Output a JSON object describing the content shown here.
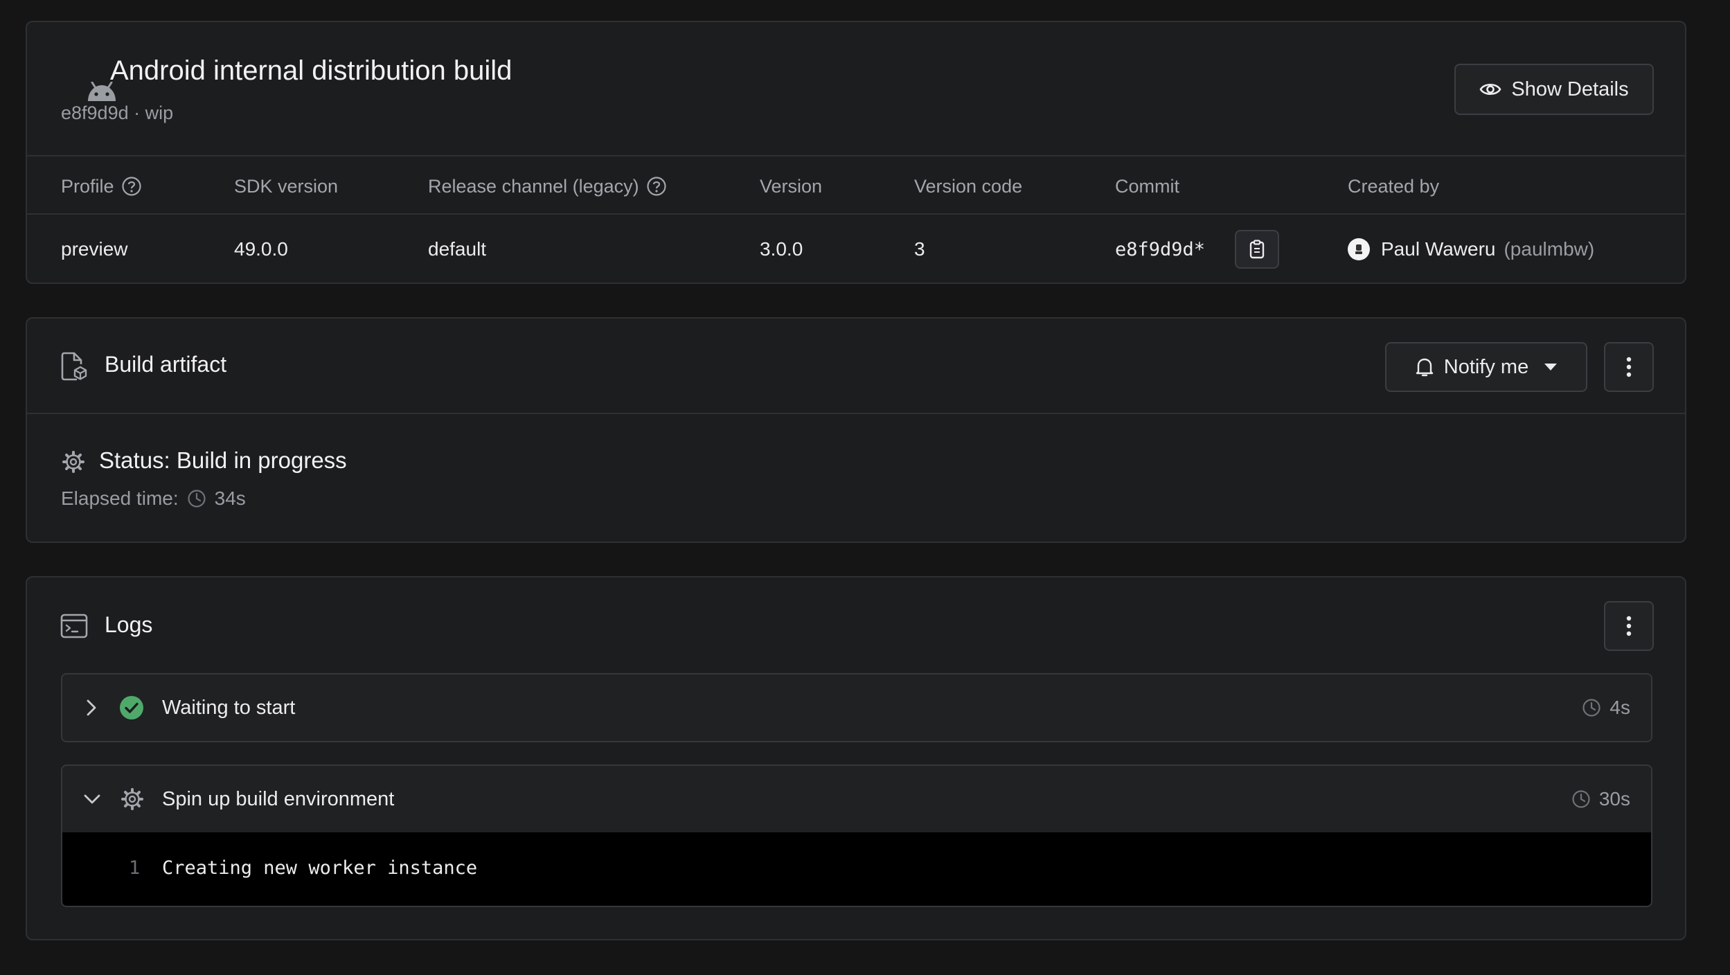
{
  "build": {
    "title": "Android internal distribution build",
    "subtitle": "e8f9d9d · wip",
    "show_details_label": "Show Details",
    "meta_headers": {
      "profile": "Profile",
      "sdk_version": "SDK version",
      "release_channel": "Release channel (legacy)",
      "version": "Version",
      "version_code": "Version code",
      "commit": "Commit",
      "created_by": "Created by"
    },
    "meta_values": {
      "profile": "preview",
      "sdk_version": "49.0.0",
      "release_channel": "default",
      "version": "3.0.0",
      "version_code": "3",
      "commit": "e8f9d9d*",
      "creator_name": "Paul Waweru",
      "creator_handle": "(paulmbw)"
    }
  },
  "artifact": {
    "title": "Build artifact",
    "notify_label": "Notify me",
    "status_text": "Status: Build in progress",
    "elapsed_label": "Elapsed time:",
    "elapsed_value": "34s"
  },
  "logs": {
    "title": "Logs",
    "steps": [
      {
        "title": "Waiting to start",
        "duration": "4s",
        "state": "completed",
        "expanded": false
      },
      {
        "title": "Spin up build environment",
        "duration": "30s",
        "state": "in-progress",
        "expanded": true,
        "lines": [
          {
            "number": "1",
            "text": "Creating new worker instance"
          }
        ]
      }
    ]
  },
  "colors": {
    "background": "#151516",
    "card": "#1c1d1f",
    "success": "#4fa96b",
    "terminal": "#000000"
  },
  "icons": [
    "android-icon",
    "eye-icon",
    "help-circle-icon",
    "clipboard-icon",
    "avatar-icon",
    "artifact-file-icon",
    "bell-icon",
    "caret-down-icon",
    "kebab-icon",
    "gear-icon",
    "clock-icon",
    "terminal-icon",
    "chevron-right-icon",
    "chevron-down-icon",
    "check-circle-icon"
  ]
}
